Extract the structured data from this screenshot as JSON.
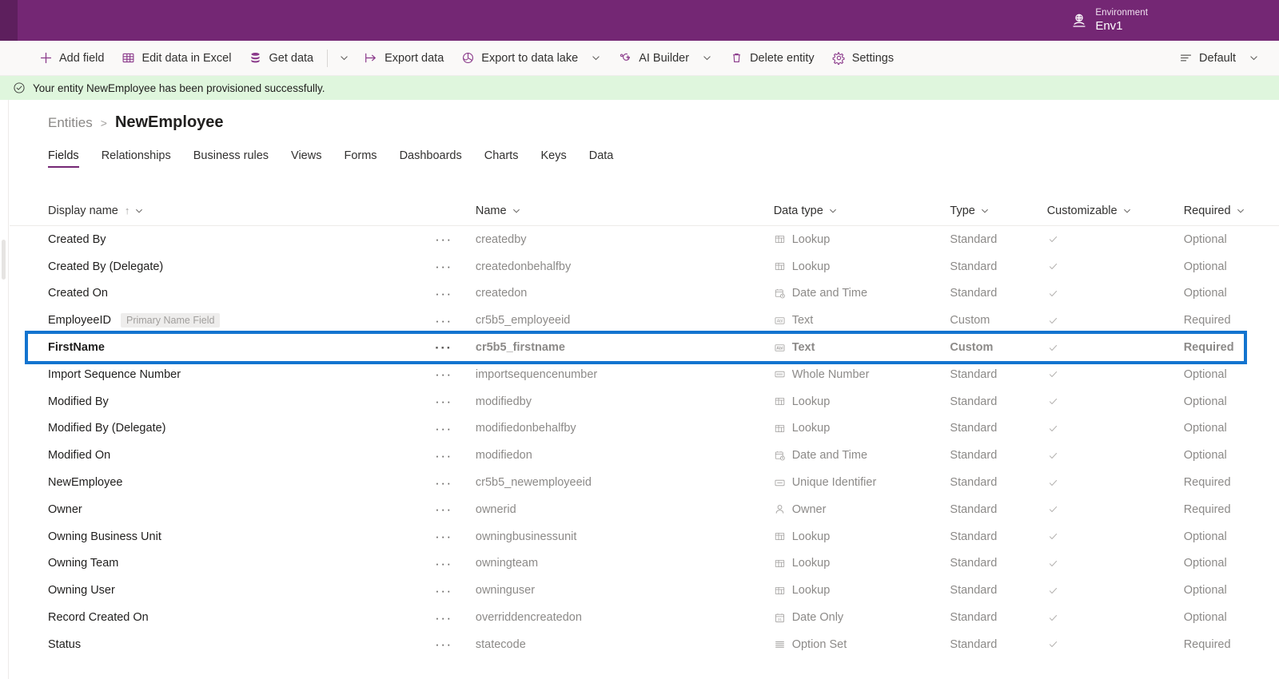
{
  "topbar": {
    "environment_label": "Environment",
    "environment_value": "Env1",
    "environment_icon": "environment-globe-icon",
    "brand_color": "#742774"
  },
  "commandbar": {
    "items": [
      {
        "label": "Add field",
        "icon": "plus-icon",
        "has_caret": false
      },
      {
        "label": "Edit data in Excel",
        "icon": "excel-icon",
        "has_caret": false
      },
      {
        "label": "Get data",
        "icon": "database-icon",
        "has_caret": false
      },
      {
        "label": "Export data",
        "icon": "export-icon",
        "has_caret": false
      },
      {
        "label": "Export to data lake",
        "icon": "data-lake-icon",
        "has_caret": true
      },
      {
        "label": "AI Builder",
        "icon": "ai-builder-icon",
        "has_caret": true
      },
      {
        "label": "Delete entity",
        "icon": "trash-icon",
        "has_caret": false
      },
      {
        "label": "Settings",
        "icon": "gear-icon",
        "has_caret": false
      }
    ],
    "standalone_caret_after_index": 2,
    "filter": {
      "label": "Default",
      "icon": "filter-lines-icon",
      "has_caret": true
    }
  },
  "banner": {
    "icon": "checkmark-circle-icon",
    "message": "Your entity NewEmployee has been provisioned successfully.",
    "background": "#dff6dd"
  },
  "breadcrumb": {
    "parent": "Entities",
    "separator": ">",
    "current": "NewEmployee"
  },
  "tabs": [
    {
      "label": "Fields",
      "active": true
    },
    {
      "label": "Relationships",
      "active": false
    },
    {
      "label": "Business rules",
      "active": false
    },
    {
      "label": "Views",
      "active": false
    },
    {
      "label": "Forms",
      "active": false
    },
    {
      "label": "Dashboards",
      "active": false
    },
    {
      "label": "Charts",
      "active": false
    },
    {
      "label": "Keys",
      "active": false
    },
    {
      "label": "Data",
      "active": false
    }
  ],
  "grid": {
    "columns": [
      {
        "label": "Display name",
        "sorted": true,
        "sort_direction": "asc",
        "has_caret": true
      },
      {
        "label": "Name",
        "sorted": false,
        "has_caret": true
      },
      {
        "label": "Data type",
        "sorted": false,
        "has_caret": true
      },
      {
        "label": "Type",
        "sorted": false,
        "has_caret": true
      },
      {
        "label": "Customizable",
        "sorted": false,
        "has_caret": true
      },
      {
        "label": "Required",
        "sorted": false,
        "has_caret": true
      }
    ],
    "sort_arrow_glyph": "↑",
    "row_menu_glyph": "···",
    "selected_row_index": 4,
    "selection_outline_color": "#1374cf",
    "rows": [
      {
        "display_name": "Created By",
        "badge": "",
        "name": "createdby",
        "data_type": "Lookup",
        "data_type_icon": "lookup-icon",
        "type": "Standard",
        "customizable": true,
        "required": "Optional"
      },
      {
        "display_name": "Created By (Delegate)",
        "badge": "",
        "name": "createdonbehalfby",
        "data_type": "Lookup",
        "data_type_icon": "lookup-icon",
        "type": "Standard",
        "customizable": true,
        "required": "Optional"
      },
      {
        "display_name": "Created On",
        "badge": "",
        "name": "createdon",
        "data_type": "Date and Time",
        "data_type_icon": "date-time-icon",
        "type": "Standard",
        "customizable": true,
        "required": "Optional"
      },
      {
        "display_name": "EmployeeID",
        "badge": "Primary Name Field",
        "name": "cr5b5_employeeid",
        "data_type": "Text",
        "data_type_icon": "text-icon",
        "type": "Custom",
        "customizable": true,
        "required": "Required"
      },
      {
        "display_name": "FirstName",
        "badge": "",
        "name": "cr5b5_firstname",
        "data_type": "Text",
        "data_type_icon": "text-icon",
        "type": "Custom",
        "customizable": true,
        "required": "Required"
      },
      {
        "display_name": "Import Sequence Number",
        "badge": "",
        "name": "importsequencenumber",
        "data_type": "Whole Number",
        "data_type_icon": "whole-number-icon",
        "type": "Standard",
        "customizable": true,
        "required": "Optional"
      },
      {
        "display_name": "Modified By",
        "badge": "",
        "name": "modifiedby",
        "data_type": "Lookup",
        "data_type_icon": "lookup-icon",
        "type": "Standard",
        "customizable": true,
        "required": "Optional"
      },
      {
        "display_name": "Modified By (Delegate)",
        "badge": "",
        "name": "modifiedonbehalfby",
        "data_type": "Lookup",
        "data_type_icon": "lookup-icon",
        "type": "Standard",
        "customizable": true,
        "required": "Optional"
      },
      {
        "display_name": "Modified On",
        "badge": "",
        "name": "modifiedon",
        "data_type": "Date and Time",
        "data_type_icon": "date-time-icon",
        "type": "Standard",
        "customizable": true,
        "required": "Optional"
      },
      {
        "display_name": "NewEmployee",
        "badge": "",
        "name": "cr5b5_newemployeeid",
        "data_type": "Unique Identifier",
        "data_type_icon": "unique-identifier-icon",
        "type": "Standard",
        "customizable": true,
        "required": "Required"
      },
      {
        "display_name": "Owner",
        "badge": "",
        "name": "ownerid",
        "data_type": "Owner",
        "data_type_icon": "owner-person-icon",
        "type": "Standard",
        "customizable": true,
        "required": "Required"
      },
      {
        "display_name": "Owning Business Unit",
        "badge": "",
        "name": "owningbusinessunit",
        "data_type": "Lookup",
        "data_type_icon": "lookup-icon",
        "type": "Standard",
        "customizable": true,
        "required": "Optional"
      },
      {
        "display_name": "Owning Team",
        "badge": "",
        "name": "owningteam",
        "data_type": "Lookup",
        "data_type_icon": "lookup-icon",
        "type": "Standard",
        "customizable": true,
        "required": "Optional"
      },
      {
        "display_name": "Owning User",
        "badge": "",
        "name": "owninguser",
        "data_type": "Lookup",
        "data_type_icon": "lookup-icon",
        "type": "Standard",
        "customizable": true,
        "required": "Optional"
      },
      {
        "display_name": "Record Created On",
        "badge": "",
        "name": "overriddencreatedon",
        "data_type": "Date Only",
        "data_type_icon": "date-only-icon",
        "type": "Standard",
        "customizable": true,
        "required": "Optional"
      },
      {
        "display_name": "Status",
        "badge": "",
        "name": "statecode",
        "data_type": "Option Set",
        "data_type_icon": "option-set-icon",
        "type": "Standard",
        "customizable": true,
        "required": "Required"
      }
    ]
  }
}
